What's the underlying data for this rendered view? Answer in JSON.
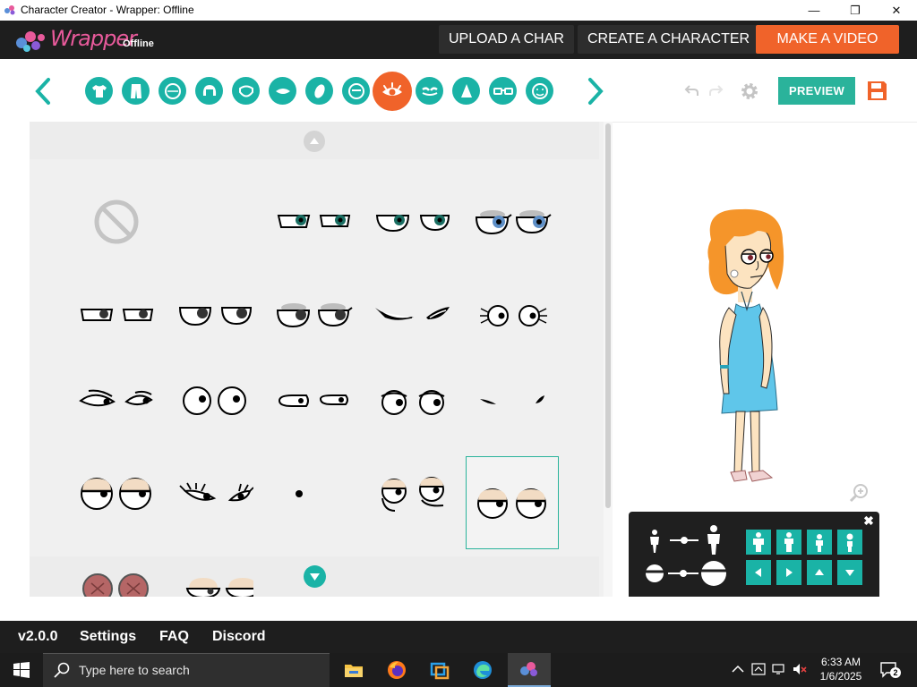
{
  "window": {
    "title": "Character Creator - Wrapper: Offline",
    "minimize": "—",
    "restore": "❐",
    "close": "✕"
  },
  "header": {
    "logo_text": "Wrapper",
    "logo_sub": "Offline",
    "upload_label": "UPLOAD A CHAR",
    "create_label": "CREATE A CHARACTER",
    "make_label": "MAKE A VIDEO"
  },
  "toolbar": {
    "categories": [
      "shirt",
      "pants",
      "head",
      "hair",
      "face",
      "mouth",
      "feet",
      "eyebrows",
      "eyes",
      "brows",
      "nose",
      "glasses",
      "beard"
    ],
    "active_category": "eyes",
    "preview_label": "PREVIEW"
  },
  "footer": {
    "version": "v2.0.0",
    "settings": "Settings",
    "faq": "FAQ",
    "discord": "Discord"
  },
  "taskbar": {
    "search_placeholder": "Type here to search",
    "time": "6:33 AM",
    "date": "1/6/2025",
    "notifications": "2"
  },
  "colors": {
    "accent": "#1ab3a6",
    "active": "#f0632a",
    "preview": "#2ab39b",
    "header_bg": "#1e1e1e"
  }
}
